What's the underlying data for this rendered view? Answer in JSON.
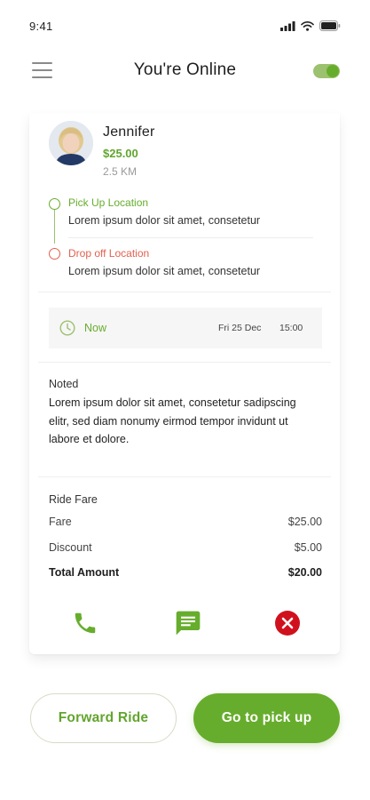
{
  "status_bar": {
    "time": "9:41"
  },
  "header": {
    "title": "You're Online",
    "online_toggle": "on"
  },
  "rider": {
    "name": "Jennifer",
    "price": "$25.00",
    "distance": "2.5 KM"
  },
  "route": {
    "pickup_label": "Pick Up Location",
    "pickup_address": "Lorem ipsum dolor sit amet, consetetur",
    "dropoff_label": "Drop off Location",
    "dropoff_address": "Lorem ipsum dolor sit amet, consetetur"
  },
  "schedule": {
    "now_label": "Now",
    "date": "Fri 25 Dec",
    "time": "15:00"
  },
  "notes": {
    "title": "Noted",
    "body": "Lorem ipsum dolor sit amet, consetetur sadipscing elitr, sed diam nonumy eirmod tempor invidunt ut labore et dolore."
  },
  "fare": {
    "title": "Ride Fare",
    "rows": [
      {
        "label": "Fare",
        "value": "$25.00"
      },
      {
        "label": "Discount",
        "value": "$5.00"
      },
      {
        "label": "Total Amount",
        "value": "$20.00"
      }
    ]
  },
  "icons": {
    "call": "phone-icon",
    "message": "chat-icon",
    "cancel": "close-circle-icon",
    "clock": "clock-icon",
    "menu": "hamburger-menu-icon"
  },
  "buttons": {
    "forward": "Forward Ride",
    "pickup": "Go to pick up"
  },
  "colors": {
    "accent": "#67ad2d",
    "drop": "#e2614f",
    "cancel": "#d0111d"
  }
}
